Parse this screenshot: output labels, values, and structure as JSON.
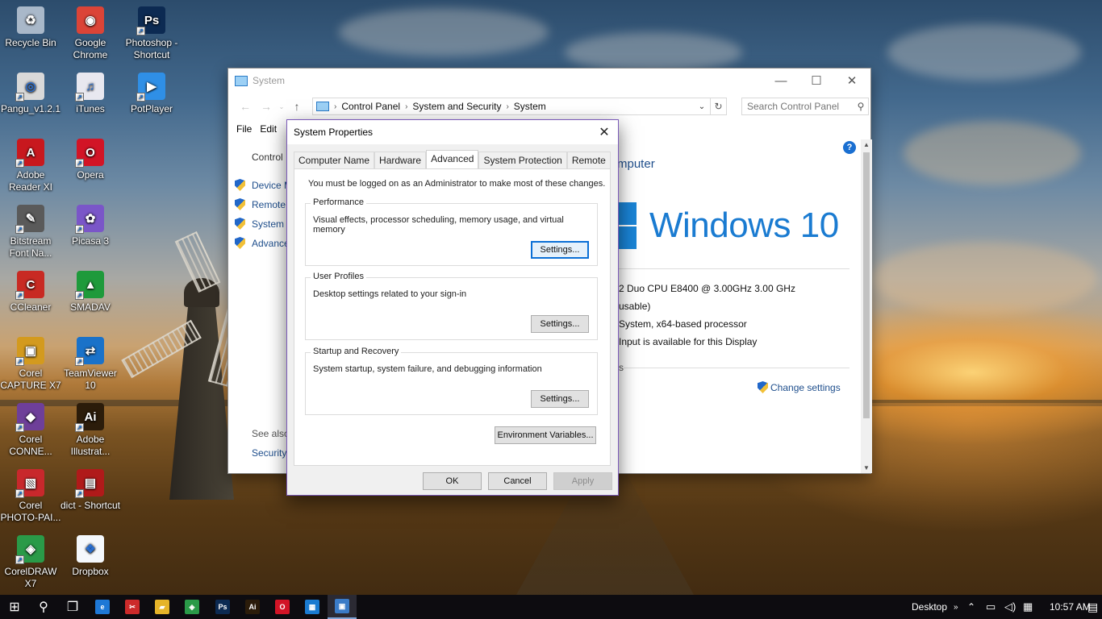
{
  "desktop": {
    "icons": [
      {
        "label": "Recycle Bin",
        "icon": "recycle-bin-icon",
        "color": "#a9b8c9",
        "glyph": "♻"
      },
      {
        "label": "Google Chrome",
        "icon": "chrome-icon",
        "color": "#db4437",
        "glyph": "◉"
      },
      {
        "label": "Photoshop - Shortcut",
        "icon": "photoshop-icon",
        "color": "#0c2a52",
        "glyph": "Ps"
      },
      {
        "label": "Pangu_v1.2.1",
        "icon": "pangu-icon",
        "color": "#d9d9d9",
        "glyph": "◎"
      },
      {
        "label": "iTunes",
        "icon": "itunes-icon",
        "color": "#e8e8f0",
        "glyph": "♫"
      },
      {
        "label": "PotPlayer",
        "icon": "potplayer-icon",
        "color": "#2f8fe6",
        "glyph": "▶"
      },
      {
        "label": "Adobe Reader XI",
        "icon": "adobe-reader-icon",
        "color": "#c8181e",
        "glyph": "A"
      },
      {
        "label": "Opera",
        "icon": "opera-icon",
        "color": "#d21426",
        "glyph": "O"
      },
      {
        "label": "Bitstream Font Na...",
        "icon": "bitstream-icon",
        "color": "#5a5a5a",
        "glyph": "✎"
      },
      {
        "label": "Picasa 3",
        "icon": "picasa-icon",
        "color": "#7a56c8",
        "glyph": "✿"
      },
      {
        "label": "CCleaner",
        "icon": "ccleaner-icon",
        "color": "#c82a23",
        "glyph": "C"
      },
      {
        "label": "SMADAV",
        "icon": "smadav-icon",
        "color": "#1e9a3b",
        "glyph": "▲"
      },
      {
        "label": "Corel CAPTURE X7",
        "icon": "corel-capture-icon",
        "color": "#d39a1e",
        "glyph": "▣"
      },
      {
        "label": "TeamViewer 10",
        "icon": "teamviewer-icon",
        "color": "#1a72c9",
        "glyph": "⇄"
      },
      {
        "label": "Corel CONNE...",
        "icon": "corel-connect-icon",
        "color": "#6e3f99",
        "glyph": "◆"
      },
      {
        "label": "Adobe Illustrat...",
        "icon": "illustrator-icon",
        "color": "#2b1c0a",
        "glyph": "Ai"
      },
      {
        "label": "Corel PHOTO-PAI...",
        "icon": "corel-photopaint-icon",
        "color": "#c8282c",
        "glyph": "▧"
      },
      {
        "label": "dict - Shortcut",
        "icon": "dict-icon",
        "color": "#b01a1a",
        "glyph": "▤"
      },
      {
        "label": "CorelDRAW X7",
        "icon": "coreldraw-icon",
        "color": "#2a9a48",
        "glyph": "◈"
      },
      {
        "label": "Dropbox",
        "icon": "dropbox-icon",
        "color": "#f5f8fc",
        "glyph": "❖"
      }
    ]
  },
  "system_window": {
    "title": "System",
    "breadcrumbs": [
      "Control Panel",
      "System and Security",
      "System"
    ],
    "search_placeholder": "Search Control Panel",
    "menu": [
      "File",
      "Edit"
    ],
    "left_title": "Control",
    "left_items": [
      "Device M",
      "Remote",
      "System p",
      "Advance"
    ],
    "see_also": "See also",
    "see_also_item": "Security",
    "heading_partial": "mputer",
    "windows_brand": "Windows 10",
    "specs": [
      "2 Duo CPU     E8400  @ 3.00GHz   3.00 GHz",
      "usable)",
      "System, x64-based processor",
      "Input is available for this Display"
    ],
    "section_partial": "s",
    "change_settings": "Change settings"
  },
  "dialog": {
    "title": "System Properties",
    "tabs": [
      "Computer Name",
      "Hardware",
      "Advanced",
      "System Protection",
      "Remote"
    ],
    "active_tab": "Advanced",
    "admin_note": "You must be logged on as an Administrator to make most of these changes.",
    "groups": [
      {
        "title": "Performance",
        "desc": "Visual effects, processor scheduling, memory usage, and virtual memory",
        "button": "Settings..."
      },
      {
        "title": "User Profiles",
        "desc": "Desktop settings related to your sign-in",
        "button": "Settings..."
      },
      {
        "title": "Startup and Recovery",
        "desc": "System startup, system failure, and debugging information",
        "button": "Settings..."
      }
    ],
    "env_button": "Environment Variables...",
    "ok": "OK",
    "cancel": "Cancel",
    "apply": "Apply"
  },
  "taskbar": {
    "apps": [
      {
        "icon": "start-icon",
        "glyph": "⊞"
      },
      {
        "icon": "search-icon",
        "glyph": "⚲"
      },
      {
        "icon": "task-view-icon",
        "glyph": "❐"
      },
      {
        "icon": "edge-icon",
        "glyph": "e"
      },
      {
        "icon": "snipping-icon",
        "glyph": "✂"
      },
      {
        "icon": "file-explorer-icon",
        "glyph": "▰"
      },
      {
        "icon": "coreldraw-taskbar-icon",
        "glyph": "◈"
      },
      {
        "icon": "photoshop-taskbar-icon",
        "glyph": "Ps"
      },
      {
        "icon": "illustrator-taskbar-icon",
        "glyph": "Ai"
      },
      {
        "icon": "opera-taskbar-icon",
        "glyph": "O"
      },
      {
        "icon": "control-panel-taskbar-icon",
        "glyph": "▦"
      },
      {
        "icon": "system-taskbar-icon",
        "glyph": "▣"
      }
    ],
    "desktop_label": "Desktop",
    "time": "10:57 AM"
  }
}
